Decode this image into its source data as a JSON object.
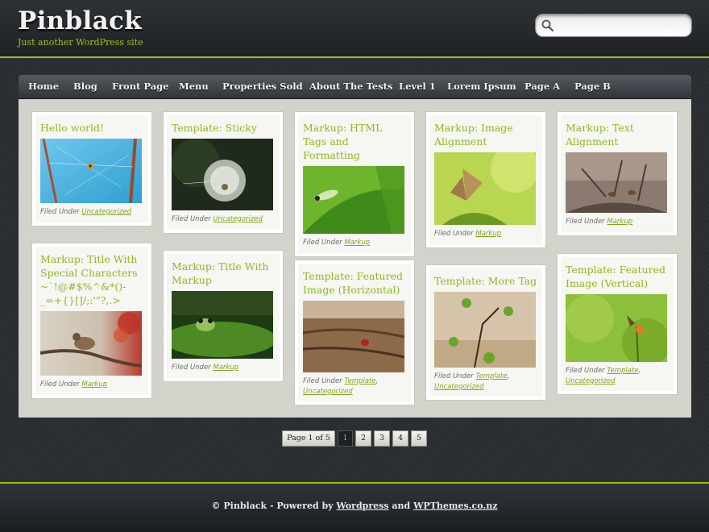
{
  "site": {
    "title": "Pinblack",
    "description": "Just another WordPress site"
  },
  "search": {
    "placeholder": "",
    "icon": "search-icon"
  },
  "nav": [
    "Home",
    "Blog",
    "Front Page",
    "Menu",
    "Properties Sold",
    "About The Tests",
    "Level 1",
    "Lorem Ipsum",
    "Page A",
    "Page B"
  ],
  "filed_label": "Filed Under",
  "posts": [
    {
      "title": "Hello world!",
      "image": "spider-web-photo",
      "categories": [
        "Uncategorized"
      ]
    },
    {
      "title": "Template: Sticky",
      "image": "dandelion-photo",
      "categories": [
        "Uncategorized"
      ]
    },
    {
      "title": "Markup: HTML Tags and Formatting",
      "image": "caterpillar-photo",
      "categories": [
        "Markup"
      ]
    },
    {
      "title": "Markup: Image Alignment",
      "image": "butterfly-photo",
      "categories": [
        "Markup"
      ]
    },
    {
      "title": "Markup: Text Alignment",
      "image": "birds-on-branches-photo",
      "categories": [
        "Markup"
      ]
    },
    {
      "title": "Markup: Title With Special Characters ~`!@#$%^&*()-_=+{}[]/;:'\"?,.>",
      "image": "sparrow-photo",
      "categories": [
        "Markup"
      ]
    },
    {
      "title": "Markup: Title With Markup",
      "image": "frog-photo",
      "categories": [
        "Markup"
      ]
    },
    {
      "title": "Template: Featured Image (Horizontal)",
      "image": "ladybug-on-wood-photo",
      "categories": [
        "Template",
        "Uncategorized"
      ]
    },
    {
      "title": "Template: More Tag",
      "image": "seed-pods-photo",
      "categories": [
        "Template",
        "Uncategorized"
      ]
    },
    {
      "title": "Template: Featured Image (Vertical)",
      "image": "butterfly-on-flower-photo",
      "categories": [
        "Template",
        "Uncategorized"
      ]
    }
  ],
  "pagination": {
    "label": "Page 1 of 5",
    "pages": [
      "1",
      "2",
      "3",
      "4",
      "5"
    ],
    "current": "1"
  },
  "footer": {
    "prefix": "© Pinblack - Powered by",
    "link1": "Wordpress",
    "and": "and",
    "link2": "WPThemes.co.nz"
  },
  "colors": {
    "accent": "#9ac21b",
    "background": "#2b2f33",
    "content": "#d3d2cb"
  }
}
